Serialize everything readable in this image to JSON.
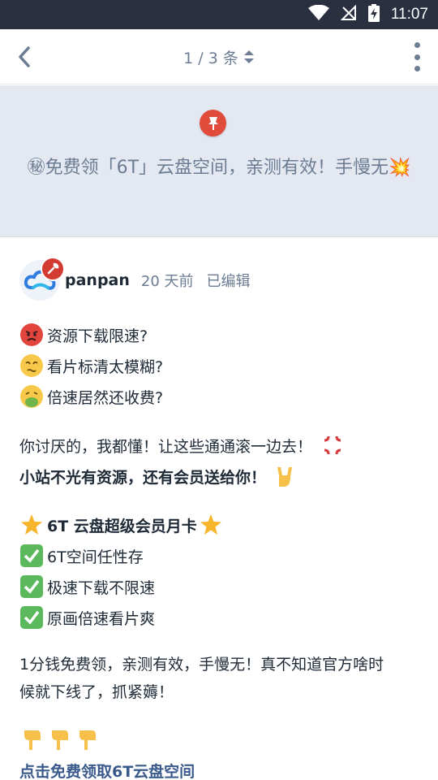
{
  "status_bar": {
    "time": "11:07"
  },
  "app_bar": {
    "pager_text": "1 / 3 条"
  },
  "banner": {
    "title": "㊙免费领「6T」云盘空间，亲测有效！手慢无💥"
  },
  "post": {
    "author": {
      "name": "panpan",
      "time": "20 天前",
      "edited": "已编辑"
    },
    "questions": [
      {
        "icon": "angry-face-icon",
        "text": "资源下载限速?"
      },
      {
        "icon": "dizzy-face-icon",
        "text": "看片标清太模糊?"
      },
      {
        "icon": "vomiting-face-icon",
        "text": "倍速居然还收费?"
      }
    ],
    "rant_line": "你讨厌的，我都懂！让这些通通滚一边去！",
    "promo_line": "小站不光有资源，还有会员送给你！",
    "offer_title": "6T 云盘超级会员月卡",
    "features": [
      {
        "icon": "check-mark-icon",
        "text": "6T空间任性存"
      },
      {
        "icon": "check-mark-icon",
        "text": "极速下载不限速"
      },
      {
        "icon": "check-mark-icon",
        "text": "原画倍速看片爽"
      }
    ],
    "closing_line1": "1分钱免费领，亲测有效，手慢无！真不知道官方啥时",
    "closing_line2": "候就下线了，抓紧薅！",
    "cta_link": "点击免费领取6T云盘空间"
  },
  "colors": {
    "accent": "#3a5a8c",
    "pin": "#e04b3c",
    "badge": "#d23a32",
    "muted": "#6b7c93",
    "banner_bg": "#e4e9f1"
  }
}
